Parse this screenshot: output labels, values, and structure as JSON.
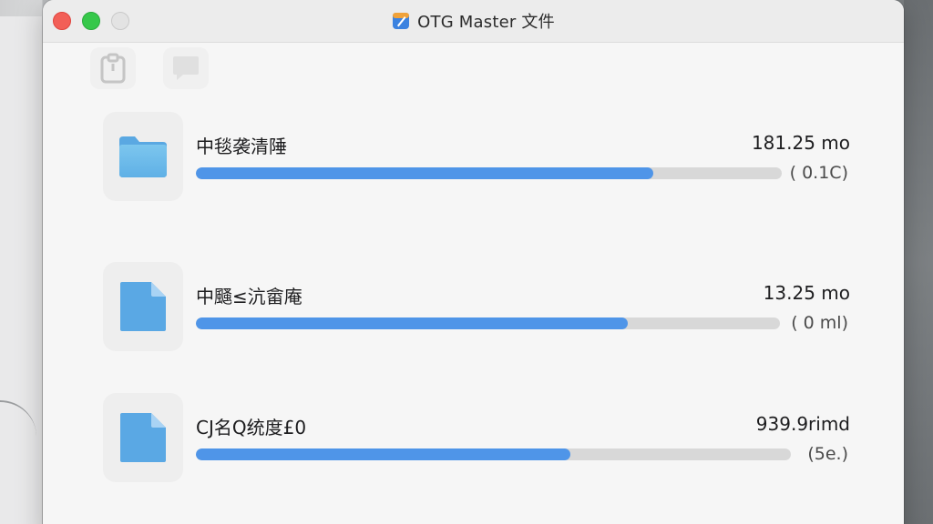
{
  "window": {
    "title": "OTG Master 文件"
  },
  "colors": {
    "accent": "#4f95e8",
    "track": "#d8d8d8",
    "close": "#f25f57",
    "minimize": "#36c84a"
  },
  "toolbar": {
    "buttons": [
      {
        "icon": "clipboard-icon"
      },
      {
        "icon": "chat-bubble-icon"
      }
    ]
  },
  "files": [
    {
      "icon": "folder-icon",
      "name": "中毯袭清陲",
      "size": "181.25 mo",
      "meta": "( 0.1C)",
      "progress": 0.78
    },
    {
      "icon": "document-icon",
      "name": "中颾≤沆畲庵",
      "size": "13.25 mo",
      "meta": "( 0 ml)",
      "progress": 0.74
    },
    {
      "icon": "document-icon",
      "name": "CJ名Q统度£0",
      "size": "939.9rimd",
      "meta": "(5e.)",
      "progress": 0.63
    }
  ]
}
